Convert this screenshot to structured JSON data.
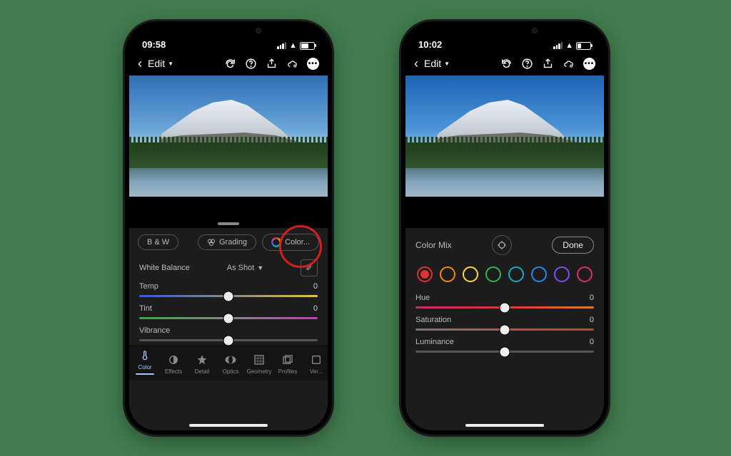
{
  "left": {
    "time": "09:58",
    "edit_label": "Edit",
    "tabs": {
      "bw": "B & W",
      "grading": "Grading",
      "colormix": "Color..."
    },
    "white_balance_label": "White Balance",
    "white_balance_value": "As Shot",
    "sliders": {
      "temp": {
        "label": "Temp",
        "value": "0"
      },
      "tint": {
        "label": "Tint",
        "value": "0"
      },
      "vibrance": {
        "label": "Vibrance",
        "value": ""
      }
    },
    "tools": [
      "Color",
      "Effects",
      "Detail",
      "Optics",
      "Geometry",
      "Profiles",
      "Ver..."
    ]
  },
  "right": {
    "time": "10:02",
    "edit_label": "Edit",
    "header": "Color Mix",
    "done": "Done",
    "swatches": [
      "#e03131",
      "#f08c00",
      "#ffd43b",
      "#37b24d",
      "#15aabf",
      "#228be6",
      "#7950f2",
      "#d6336c"
    ],
    "sliders": {
      "hue": {
        "label": "Hue",
        "value": "0"
      },
      "sat": {
        "label": "Saturation",
        "value": "0"
      },
      "lum": {
        "label": "Luminance",
        "value": "0"
      }
    }
  }
}
